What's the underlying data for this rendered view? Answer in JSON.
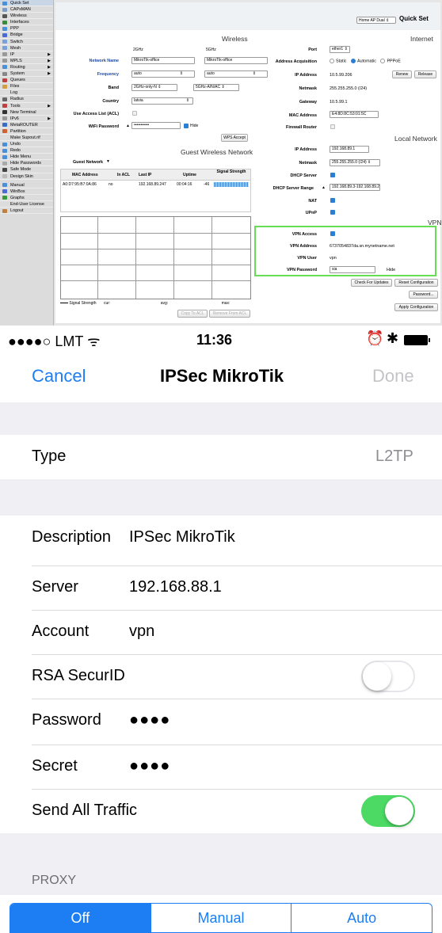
{
  "sidebar": {
    "items": [
      {
        "label": "Quick Set",
        "color": "#4a90d9",
        "arrow": false
      },
      {
        "label": "CAPsMAN",
        "color": "#7a9cc8",
        "arrow": false
      },
      {
        "label": "Wireless",
        "color": "#555555",
        "arrow": false
      },
      {
        "label": "Interfaces",
        "color": "#3a8a3a",
        "arrow": false
      },
      {
        "label": "PPP",
        "color": "#4a90d9",
        "arrow": false
      },
      {
        "label": "Bridge",
        "color": "#4a6ad9",
        "arrow": false
      },
      {
        "label": "Switch",
        "color": "#7aa0d9",
        "arrow": false
      },
      {
        "label": "Mesh",
        "color": "#7aa0d9",
        "arrow": false
      },
      {
        "label": "IP",
        "color": "#999999",
        "arrow": true
      },
      {
        "label": "MPLS",
        "color": "#999999",
        "arrow": true
      },
      {
        "label": "Routing",
        "color": "#4a90d9",
        "arrow": true
      },
      {
        "label": "System",
        "color": "#888888",
        "arrow": true
      },
      {
        "label": "Queues",
        "color": "#c04040",
        "arrow": false
      },
      {
        "label": "Files",
        "color": "#d0a040",
        "arrow": false
      },
      {
        "label": "Log",
        "color": "#dddddd",
        "arrow": false
      },
      {
        "label": "Radius",
        "color": "#666666",
        "arrow": false
      },
      {
        "label": "Tools",
        "color": "#c04040",
        "arrow": true
      },
      {
        "label": "New Terminal",
        "color": "#333333",
        "arrow": false
      },
      {
        "label": "IPv6",
        "color": "#999999",
        "arrow": true
      },
      {
        "label": "MetaROUTER",
        "color": "#3a6ac8",
        "arrow": false
      },
      {
        "label": "Partition",
        "color": "#d06030",
        "arrow": false
      },
      {
        "label": "Make Supout.rif",
        "color": "#dddddd",
        "arrow": false
      },
      {
        "label": "Undo",
        "color": "#4a90d9",
        "arrow": false
      },
      {
        "label": "Redo",
        "color": "#4a90d9",
        "arrow": false
      },
      {
        "label": "Hide Menu",
        "color": "#4a90d9",
        "arrow": false
      },
      {
        "label": "Hide Passwords",
        "color": "#aaaaaa",
        "arrow": false
      },
      {
        "label": "Safe Mode",
        "color": "#444444",
        "arrow": false
      },
      {
        "label": "Design Skin",
        "color": "#bbbbbb",
        "arrow": false
      },
      {
        "label": "Manual",
        "color": "#4a90d9",
        "arrow": false
      },
      {
        "label": "WinBox",
        "color": "#4a6ad9",
        "arrow": false
      },
      {
        "label": "Graphs",
        "color": "#3a9a3a",
        "arrow": false
      },
      {
        "label": "End-User License",
        "color": "#dddddd",
        "arrow": false
      },
      {
        "label": "Logout",
        "color": "#c08040",
        "arrow": false
      }
    ]
  },
  "quickset": {
    "mode_select": "Home AP Dual ⇕",
    "title": "Quick Set",
    "wireless": {
      "title": "Wireless",
      "col_2ghz": "2GHz",
      "col_5ghz": "5GHz",
      "network_name_label": "Network Name",
      "network_name_2": "MikroTik-office",
      "network_name_5": "MikroTik-office",
      "frequency_label": "Frequency",
      "frequency_2": "auto",
      "frequency_5": "auto",
      "band_label": "Band",
      "band_2": "2GHz-only-N",
      "band_5": "5GHz-A/N/AC",
      "country_label": "Country",
      "country": "latvia",
      "acl_label": "Use Access List (ACL)",
      "wifi_password_label": "WiFi Password",
      "wifi_password": "•••••••••••",
      "hide_label": "Hide",
      "wps_button": "WPS Accept"
    },
    "guest": {
      "title": "Guest Wireless Network",
      "network_label": "Guest Network",
      "table_headers": [
        "MAC Address",
        "In ACL",
        "Last IP",
        "Uptime",
        "Signal Strength"
      ],
      "table_rows": [
        {
          "mac": "A0:D7:95:B7:0A:86",
          "acl": "no",
          "ip": "192.168.89.247",
          "uptime": "00:04:16",
          "signal": "-46"
        }
      ],
      "legend_signal": "Signal Strength",
      "legend_cur": "cur:",
      "legend_avg": "avg:",
      "legend_max": "max:",
      "copy_acl": "Copy To ACL",
      "remove_acl": "Remove From ACL"
    },
    "internet": {
      "title": "Internet",
      "port_label": "Port",
      "port": "ether1",
      "acq_label": "Address Acquisition",
      "acq_static": "Static",
      "acq_auto": "Automatic",
      "acq_pppoe": "PPPoE",
      "ip_label": "IP Address",
      "ip": "10.5.99.206",
      "renew": "Renew",
      "release": "Release",
      "netmask_label": "Netmask",
      "netmask": "255.255.255.0 (/24)",
      "gateway_label": "Gateway",
      "gateway": "10.5.99.1",
      "mac_label": "MAC Address",
      "mac": "E4:8D:8C:53:01:5C",
      "firewall_label": "Firewall Router"
    },
    "local": {
      "title": "Local Network",
      "ip_label": "IP Address",
      "ip": "192.168.89.1",
      "netmask_label": "Netmask",
      "netmask": "255.255.255.0 (/24)",
      "dhcp_label": "DHCP Server",
      "range_label": "DHCP Server Range",
      "range": "192.168.89.3-192.168.89.2",
      "nat_label": "NAT",
      "upnp_label": "UPnP"
    },
    "vpn": {
      "title": "VPN",
      "access_label": "VPN Access",
      "address_label": "VPN Address",
      "address": "6737054837da.sn.mynetname.net",
      "user_label": "VPN User",
      "user": "vpn",
      "password_label": "VPN Password",
      "password": "sia",
      "hide_label": "Hide"
    },
    "buttons": {
      "check_updates": "Check For Updates",
      "reset_config": "Reset Configuration",
      "password": "Password...",
      "apply": "Apply Configuration"
    }
  },
  "ios": {
    "status": {
      "carrier": "●●●●○ LMT",
      "time": "11:36"
    },
    "nav": {
      "cancel": "Cancel",
      "title": "IPSec MikroTik",
      "done": "Done"
    },
    "type": {
      "label": "Type",
      "value": "L2TP"
    },
    "description": {
      "label": "Description",
      "value": "IPSec MikroTik"
    },
    "server": {
      "label": "Server",
      "value": "192.168.88.1"
    },
    "account": {
      "label": "Account",
      "value": "vpn"
    },
    "rsa": {
      "label": "RSA SecurID"
    },
    "password": {
      "label": "Password",
      "value": "●●●●"
    },
    "secret": {
      "label": "Secret",
      "value": "●●●●"
    },
    "send_all": {
      "label": "Send All Traffic"
    },
    "proxy": {
      "header": "PROXY",
      "off": "Off",
      "manual": "Manual",
      "auto": "Auto"
    }
  },
  "colors": {
    "ios_blue": "#1c7ef2",
    "ios_green": "#4cd964",
    "highlight": "#66dd55"
  }
}
